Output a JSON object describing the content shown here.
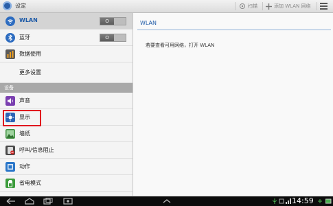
{
  "app": {
    "title": "设定",
    "icon": "settings-gear-icon"
  },
  "actions": {
    "scan_label": "扫描",
    "add_label": "添加 WLAN 网络"
  },
  "sidebar": {
    "items": [
      {
        "label": "WLAN",
        "icon": "wifi-icon",
        "toggle": "O",
        "selected": true
      },
      {
        "label": "蓝牙",
        "icon": "bluetooth-icon",
        "toggle": "O"
      },
      {
        "label": "数据使用",
        "icon": "data-usage-icon"
      },
      {
        "label": "更多设置",
        "icon": ""
      }
    ],
    "section_header": "设备",
    "device_items": [
      {
        "label": "声音",
        "icon": "sound-icon"
      },
      {
        "label": "显示",
        "icon": "display-icon",
        "highlighted": true
      },
      {
        "label": "墙纸",
        "icon": "wallpaper-icon"
      },
      {
        "label": "呼叫/信息阻止",
        "icon": "call-block-icon"
      },
      {
        "label": "动作",
        "icon": "motion-icon"
      },
      {
        "label": "省电模式",
        "icon": "power-saving-icon"
      }
    ]
  },
  "detail": {
    "title": "WLAN",
    "message": "若要查看可用网络，打开 WLAN"
  },
  "status_bar": {
    "time": "14:59"
  },
  "colors": {
    "accent": "#1d5aa7",
    "highlight": "#e0141e",
    "navbar": "#0c0c0c"
  }
}
